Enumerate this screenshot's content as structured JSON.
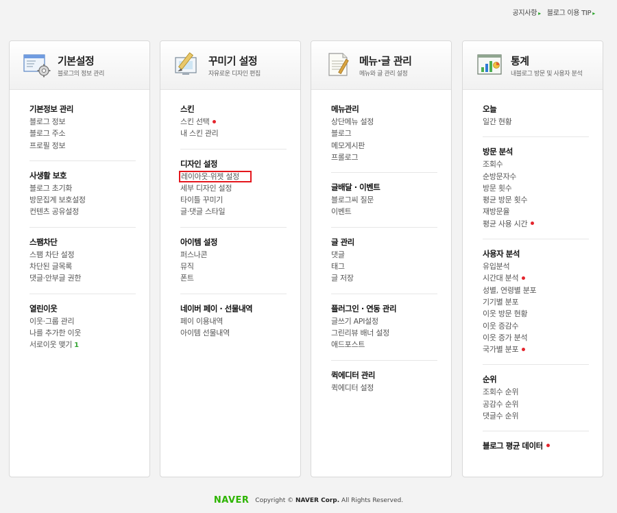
{
  "top_links": [
    "공지사항",
    "블로그 이용 TIP"
  ],
  "panels": [
    {
      "title": "기본설정",
      "subtitle": "블로그의 정보 관리",
      "icon": "settings-window-gear-icon",
      "sections": [
        {
          "title": "기본정보 관리",
          "items": [
            "블로그 정보",
            "블로그 주소",
            "프로필 정보"
          ]
        },
        {
          "title": "사생활 보호",
          "items": [
            "블로그 초기화",
            "방문집계 보호설정",
            "컨텐츠 공유설정"
          ]
        },
        {
          "title": "스팸차단",
          "items": [
            "스팸 차단 설정",
            "차단된 글목록",
            "댓글·안부글 권한"
          ]
        },
        {
          "title": "열린이웃",
          "items": [
            "이웃·그룹 관리",
            "나를 추가한 이웃",
            "서로이웃 맺기"
          ],
          "badge": "1"
        }
      ]
    },
    {
      "title": "꾸미기 설정",
      "subtitle": "자유로운 디자인 편집",
      "icon": "design-brush-icon",
      "sections": [
        {
          "title": "스킨",
          "items": [
            "스킨 선택",
            "내 스킨 관리"
          ]
        },
        {
          "title": "디자인 설정",
          "items": [
            "레이아웃·위젯 설정",
            "세부 디자인 설정",
            "타이틀 꾸미기",
            "글·댓글 스타일"
          ]
        },
        {
          "title": "아이템 설정",
          "items": [
            "퍼스나콘",
            "뮤직",
            "폰트"
          ]
        },
        {
          "title": "네이버 페이 · 선물내역",
          "items": [
            "페이 이용내역",
            "아이템 선물내역"
          ]
        }
      ]
    },
    {
      "title": "메뉴·글 관리",
      "subtitle": "메뉴와 글 관리 설정",
      "icon": "document-pen-icon",
      "sections": [
        {
          "title": "메뉴관리",
          "items": [
            "상단메뉴 설정",
            "블로그",
            "메모게시판",
            "프롤로그"
          ]
        },
        {
          "title": "글배달 · 이벤트",
          "items": [
            "블로그씨 질문",
            "이벤트"
          ]
        },
        {
          "title": "글 관리",
          "items": [
            "댓글",
            "태그",
            "글 저장"
          ]
        },
        {
          "title": "플러그인 · 연동 관리",
          "items": [
            "글쓰기 API설정",
            "그린리뷰 배너 설정",
            "애드포스트"
          ]
        },
        {
          "title": "퀵에디터 관리",
          "items": [
            "퀵에디터 설정"
          ]
        }
      ]
    },
    {
      "title": "통계",
      "subtitle": "내블로그 방문 및 사용자 분석",
      "icon": "statistics-chart-icon",
      "sections": [
        {
          "title": "오늘",
          "items": [
            "일간 현황"
          ]
        },
        {
          "title": "방문 분석",
          "items": [
            "조회수",
            "순방문자수",
            "방문 횟수",
            "평균 방문 횟수",
            "재방문율",
            "평균 사용 시간"
          ]
        },
        {
          "title": "사용자 분석",
          "items": [
            "유입분석",
            "시간대 분석",
            "성별, 연령별 분포",
            "기기별 분포",
            "이웃 방문 현황",
            "이웃 증감수",
            "이웃 증가 분석",
            "국가별 분포"
          ]
        },
        {
          "title": "순위",
          "items": [
            "조회수 순위",
            "공감수 순위",
            "댓글수 순위"
          ]
        },
        {
          "title": "블로그 평균 데이터",
          "items": []
        }
      ]
    }
  ],
  "footer": {
    "logo": "NAVER",
    "copyright_prefix": "Copyright ©",
    "company": "NAVER Corp.",
    "rights": "All Rights Reserved."
  },
  "colors": {
    "new_dot": "#e4252d",
    "highlight_box": "#e4161c",
    "brand_green": "#2db400"
  }
}
